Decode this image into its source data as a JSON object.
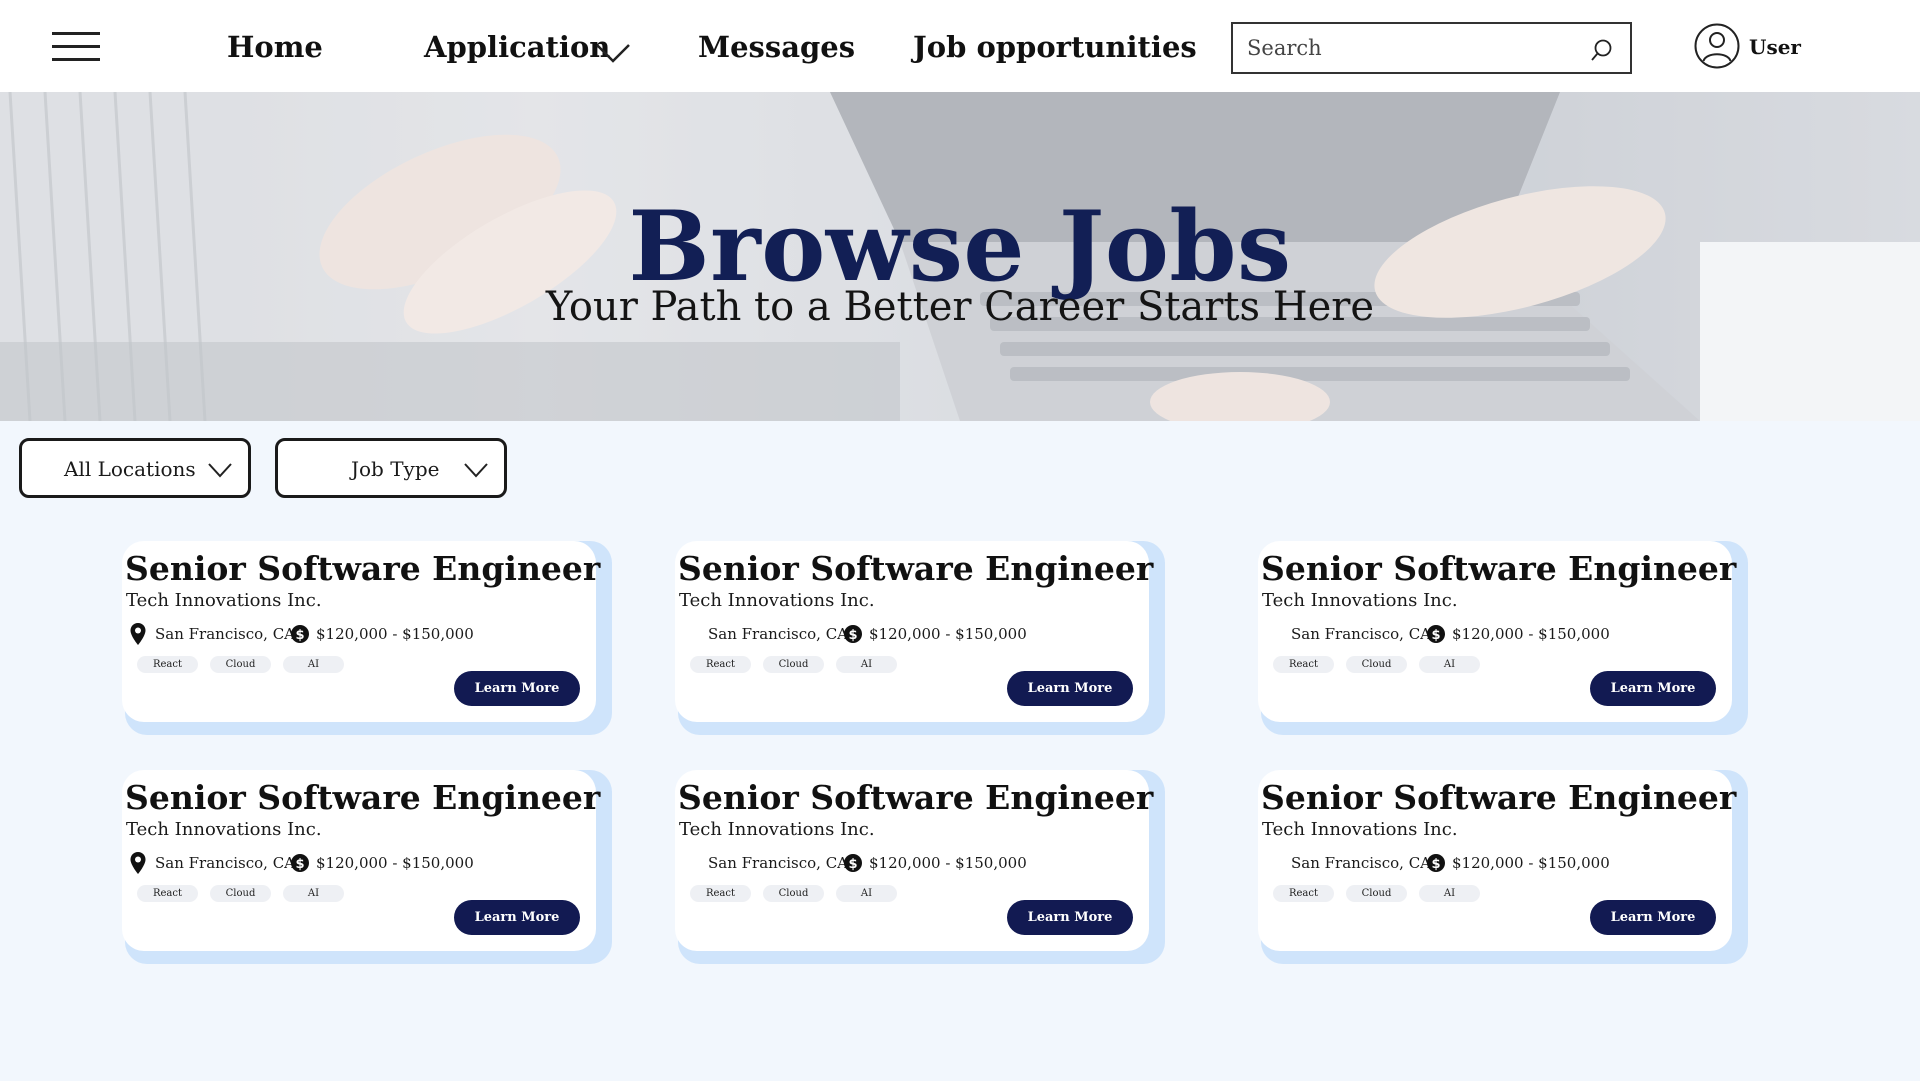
{
  "nav": {
    "menu_icon": "hamburger-menu-icon",
    "links": {
      "home": "Home",
      "application": "Application",
      "messages": "Messages",
      "job_opportunities": "Job opportunities"
    },
    "search": {
      "placeholder": "Search",
      "icon": "search-icon"
    },
    "user": {
      "label": "User",
      "icon": "user-circle-icon"
    }
  },
  "hero": {
    "title": "Browse Jobs",
    "subtitle": "Your Path to a Better Career Starts Here"
  },
  "filters": {
    "location": "All Locations",
    "job_type": "Job Type"
  },
  "jobs": [
    {
      "title": "Senior Software Engineer",
      "company": "Tech Innovations Inc.",
      "location": "San Francisco, CA",
      "salary": "$120,000 - $150,000",
      "tags": [
        "React",
        "Cloud",
        "AI"
      ],
      "button": "Learn More"
    },
    {
      "title": "Senior Software Engineer",
      "company": "Tech Innovations Inc.",
      "location": "San Francisco, CA",
      "salary": "$120,000 - $150,000",
      "tags": [
        "React",
        "Cloud",
        "AI"
      ],
      "button": "Learn More"
    },
    {
      "title": "Senior Software Engineer",
      "company": "Tech Innovations Inc.",
      "location": "San Francisco, CA",
      "salary": "$120,000 - $150,000",
      "tags": [
        "React",
        "Cloud",
        "AI"
      ],
      "button": "Learn More"
    },
    {
      "title": "Senior Software Engineer",
      "company": "Tech Innovations Inc.",
      "location": "San Francisco, CA",
      "salary": "$120,000 - $150,000",
      "tags": [
        "React",
        "Cloud",
        "AI"
      ],
      "button": "Learn More"
    },
    {
      "title": "Senior Software Engineer",
      "company": "Tech Innovations Inc.",
      "location": "San Francisco, CA",
      "salary": "$120,000 - $150,000",
      "tags": [
        "React",
        "Cloud",
        "AI"
      ],
      "button": "Learn More"
    },
    {
      "title": "Senior Software Engineer",
      "company": "Tech Innovations Inc.",
      "location": "San Francisco, CA",
      "salary": "$120,000 - $150,000",
      "tags": [
        "React",
        "Cloud",
        "AI"
      ],
      "button": "Learn More"
    }
  ],
  "colors": {
    "brand_navy": "#121a52",
    "page_bg": "#f2f7fd",
    "card_shadow": "#cfe4fb"
  }
}
